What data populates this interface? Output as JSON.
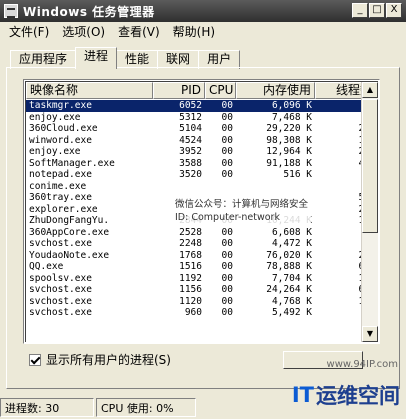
{
  "window": {
    "title": "Windows 任务管理器",
    "minimize": "_",
    "maximize": "□",
    "close": "X"
  },
  "menu": [
    "文件(F)",
    "选项(O)",
    "查看(V)",
    "帮助(H)"
  ],
  "tabs": [
    "应用程序",
    "进程",
    "性能",
    "联网",
    "用户"
  ],
  "active_tab": "进程",
  "table": {
    "columns": [
      "映像名称",
      "PID",
      "CPU",
      "内存使用",
      "线程数"
    ],
    "rows": [
      {
        "name": "taskmgr.exe",
        "pid": "6052",
        "cpu": "00",
        "mem": "6,096 K",
        "threads": "4"
      },
      {
        "name": "enjoy.exe",
        "pid": "5312",
        "cpu": "00",
        "mem": "7,468 K",
        "threads": "9"
      },
      {
        "name": "360Cloud.exe",
        "pid": "5104",
        "cpu": "00",
        "mem": "29,220 K",
        "threads": "23"
      },
      {
        "name": "winword.exe",
        "pid": "4524",
        "cpu": "00",
        "mem": "98,308 K",
        "threads": "11"
      },
      {
        "name": "enjoy.exe",
        "pid": "3952",
        "cpu": "00",
        "mem": "12,964 K",
        "threads": "29"
      },
      {
        "name": "SoftManager.exe",
        "pid": "3588",
        "cpu": "00",
        "mem": "91,188 K",
        "threads": "46"
      },
      {
        "name": "notepad.exe",
        "pid": "3520",
        "cpu": "00",
        "mem": "516 K",
        "threads": "2"
      },
      {
        "name": "conime.exe",
        "pid": "",
        "cpu": "",
        "mem": "",
        "threads": "1"
      },
      {
        "name": "360tray.exe",
        "pid": "",
        "cpu": "",
        "mem": "",
        "threads": "59"
      },
      {
        "name": "explorer.exe",
        "pid": "",
        "cpu": "",
        "mem": "",
        "threads": "20"
      },
      {
        "name": "ZhuDongFangYu.",
        "pid": "2844",
        "cpu": "00",
        "mem": "10,244 K",
        "threads": "10"
      },
      {
        "name": "360AppCore.exe",
        "pid": "2528",
        "cpu": "00",
        "mem": "6,608 K",
        "threads": "6"
      },
      {
        "name": "svchost.exe",
        "pid": "2248",
        "cpu": "00",
        "mem": "4,472 K",
        "threads": "6"
      },
      {
        "name": "YoudaoNote.exe",
        "pid": "1768",
        "cpu": "00",
        "mem": "76,020 K",
        "threads": "20"
      },
      {
        "name": "QQ.exe",
        "pid": "1516",
        "cpu": "00",
        "mem": "78,888 K",
        "threads": "61"
      },
      {
        "name": "spoolsv.exe",
        "pid": "1192",
        "cpu": "00",
        "mem": "7,704 K",
        "threads": "13"
      },
      {
        "name": "svchost.exe",
        "pid": "1156",
        "cpu": "00",
        "mem": "24,264 K",
        "threads": "62"
      },
      {
        "name": "svchost.exe",
        "pid": "1120",
        "cpu": "00",
        "mem": "4,768 K",
        "threads": "11"
      },
      {
        "name": "svchost.exe",
        "pid": "960",
        "cpu": "00",
        "mem": "5,492 K",
        "threads": "6"
      }
    ]
  },
  "show_all_users": {
    "label": "显示所有用户的进程(S)",
    "checked": true
  },
  "status": {
    "processes": "进程数: 30",
    "cpu": "CPU 使用: 0%"
  },
  "watermark": {
    "line1": "微信公众号：计算机与网络安全",
    "line2": "ID: Computer-network",
    "url": "www.94IP.com",
    "logo_it": "IT",
    "logo_text": "运维空间"
  }
}
